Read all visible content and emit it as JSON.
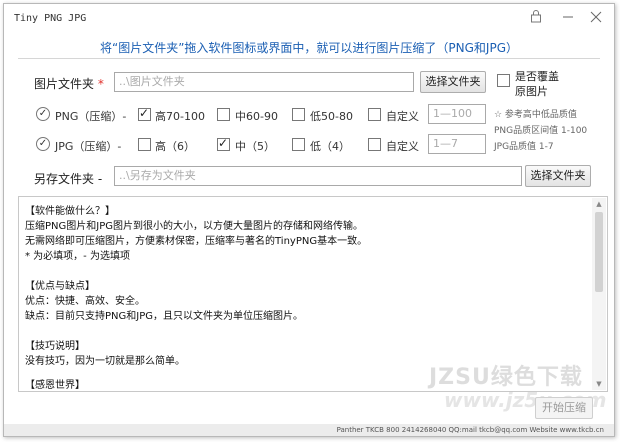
{
  "window": {
    "title": "Tiny PNG JPG",
    "lock_icon": "lock-icon",
    "minimize_icon": "minimize-icon",
    "close_icon": "close-icon"
  },
  "banner": "将“图片文件夹”拖入软件图标或界面中，就可以进行图片压缩了（PNG和JPG）",
  "image_folder": {
    "label": "图片文件夹",
    "required_mark": "*",
    "placeholder": "..\\图片文件夹",
    "browse_label": "选择文件夹",
    "overwrite_label_1": "是否覆盖",
    "overwrite_label_2": "原图片",
    "overwrite_checked": false
  },
  "png": {
    "label": "PNG（压缩）-",
    "enabled": true,
    "options": [
      {
        "label": "高70-100",
        "checked": true
      },
      {
        "label": "中60-90",
        "checked": false
      },
      {
        "label": "低50-80",
        "checked": false
      }
    ],
    "custom_label": "自定义",
    "custom_placeholder": "1—100"
  },
  "jpg": {
    "label": "JPG（压缩）-",
    "enabled": true,
    "options": [
      {
        "label": "高（6）",
        "checked": false
      },
      {
        "label": "中（5）",
        "checked": true
      },
      {
        "label": "低（4）",
        "checked": false
      }
    ],
    "custom_label": "自定义",
    "custom_placeholder": "1—7"
  },
  "reference": {
    "line1": "☆ 参考高中低品质值",
    "line2": "PNG品质区间值 1-100",
    "line3": "JPG品质值 1-7"
  },
  "save_folder": {
    "label": "另存文件夹 -",
    "placeholder": "..\\另存为文件夹",
    "browse_label": "选择文件夹"
  },
  "info_text": [
    "【软件能做什么？】",
    "压缩PNG图片和JPG图片到很小的大小，以方便大量图片的存储和网络传输。",
    "无需网络即可压缩图片，方便素材保密，压缩率与著名的TinyPNG基本一致。",
    "* 为必填项，- 为选填项",
    "",
    "【优点与缺点】",
    "优点：快捷、高效、安全。",
    "缺点：目前只支持PNG和JPG，且只以文件夹为单位压缩图片。",
    "",
    "【技巧说明】",
    "没有技巧，因为一切就是那么简单。",
    "",
    "【感恩世界】"
  ],
  "start_label": "开始压缩",
  "watermark_1": "JZSU绿色下载",
  "watermark_2": "www.jz5u.com",
  "status_text": "Panther TKCB  800 2414268040  QQ:mail tkcb@qq.com  Website www.tkcb.cn"
}
